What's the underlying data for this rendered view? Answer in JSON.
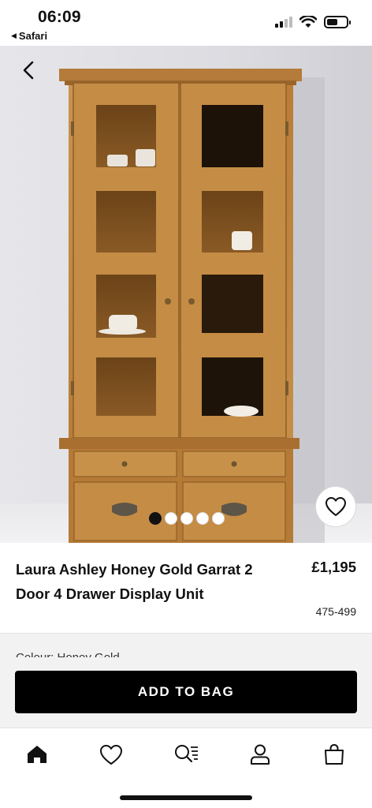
{
  "status_bar": {
    "time": "06:09",
    "back_app": "Safari",
    "back_arrow": "◀"
  },
  "hero": {
    "image_subject": "honey-gold wooden glazed display cabinet",
    "carousel_count": 5,
    "carousel_active_index": 0
  },
  "product": {
    "title": "Laura Ashley Honey Gold Garrat 2 Door 4 Drawer Display Unit",
    "price": "£1,195",
    "code": "475-499",
    "colour_peek": "Colour:   Honey Gold"
  },
  "actions": {
    "add_to_bag": "ADD TO BAG"
  },
  "tabbar": {
    "items": [
      "home-icon",
      "heart-icon",
      "search-list-icon",
      "account-icon",
      "bag-icon"
    ]
  },
  "colors": {
    "primary": "#000000",
    "wood": "#c08a42",
    "wall": "#e0e0e5"
  }
}
